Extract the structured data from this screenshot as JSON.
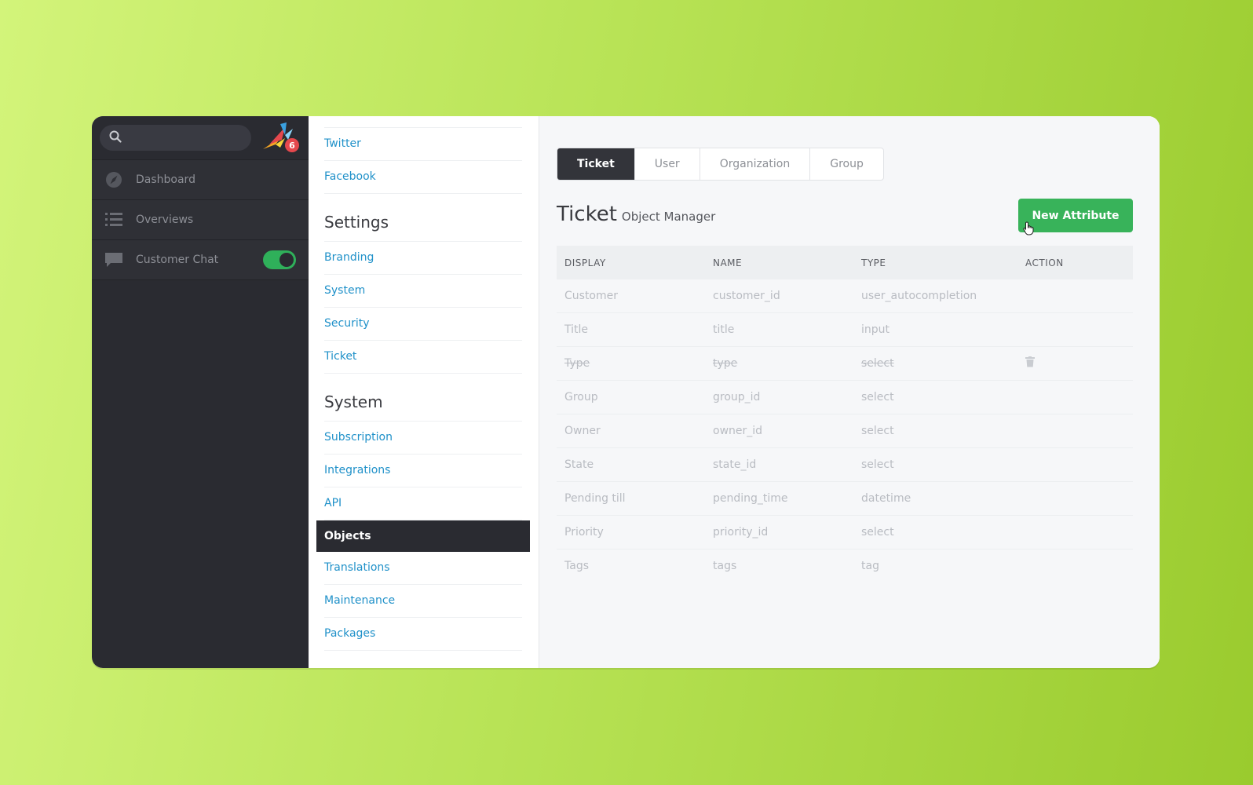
{
  "nav": {
    "items": [
      {
        "label": "Dashboard",
        "icon": "dashboard-icon"
      },
      {
        "label": "Overviews",
        "icon": "list-icon"
      },
      {
        "label": "Customer Chat",
        "icon": "chat-icon",
        "toggle_on": true
      }
    ],
    "notification_count": "6",
    "toggle_color": "#2fb05a"
  },
  "settings": {
    "channels_links": [
      "Twitter",
      "Facebook"
    ],
    "settings_heading": "Settings",
    "settings_links": [
      "Branding",
      "System",
      "Security",
      "Ticket"
    ],
    "system_heading": "System",
    "system_links": [
      "Subscription",
      "Integrations",
      "API"
    ],
    "active_link": "Objects",
    "more_links": [
      "Translations",
      "Maintenance",
      "Packages"
    ]
  },
  "main": {
    "tabs": [
      "Ticket",
      "User",
      "Organization",
      "Group"
    ],
    "active_tab": "Ticket",
    "title": "Ticket",
    "subtitle": "Object Manager",
    "new_button": "New Attribute",
    "accent_color": "#38b35a",
    "columns": [
      "DISPLAY",
      "NAME",
      "TYPE",
      "ACTION"
    ],
    "rows": [
      {
        "display": "Customer",
        "name": "customer_id",
        "type": "user_autocompletion"
      },
      {
        "display": "Title",
        "name": "title",
        "type": "input"
      },
      {
        "display": "Type",
        "name": "type",
        "type": "select",
        "struck": true,
        "action_icon": "trash-icon"
      },
      {
        "display": "Group",
        "name": "group_id",
        "type": "select"
      },
      {
        "display": "Owner",
        "name": "owner_id",
        "type": "select"
      },
      {
        "display": "State",
        "name": "state_id",
        "type": "select"
      },
      {
        "display": "Pending till",
        "name": "pending_time",
        "type": "datetime"
      },
      {
        "display": "Priority",
        "name": "priority_id",
        "type": "select"
      },
      {
        "display": "Tags",
        "name": "tags",
        "type": "tag"
      }
    ]
  }
}
